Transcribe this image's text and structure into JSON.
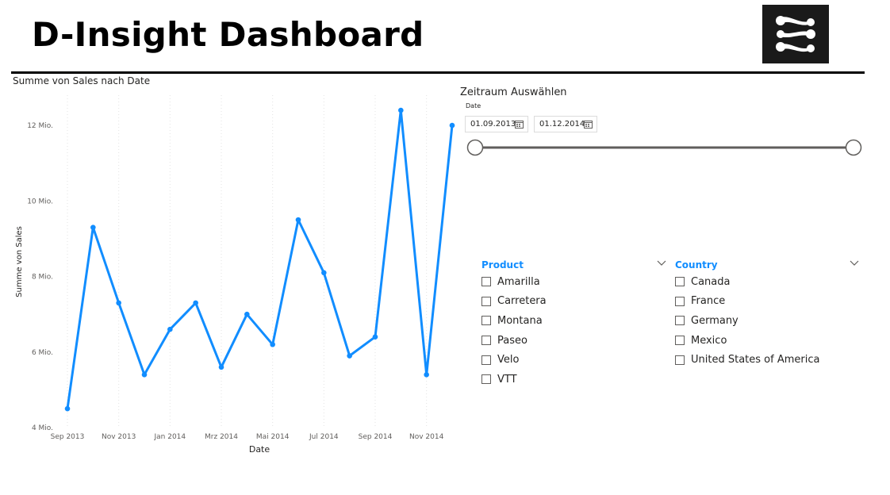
{
  "header": {
    "title": "D-Insight Dashboard",
    "logo_icon": "connected-nodes-logo-icon"
  },
  "chart_data": {
    "type": "line",
    "title": "Summe von Sales nach Date",
    "xlabel": "Date",
    "ylabel": "Summe von Sales",
    "x": [
      "2013-09",
      "2013-10",
      "2013-11",
      "2013-12",
      "2014-01",
      "2014-02",
      "2014-03",
      "2014-04",
      "2014-05",
      "2014-06",
      "2014-07",
      "2014-08",
      "2014-09",
      "2014-10",
      "2014-11",
      "2014-12"
    ],
    "x_ticks": [
      "Sep 2013",
      "Nov 2013",
      "Jan 2014",
      "Mrz 2014",
      "Mai 2014",
      "Jul 2014",
      "Sep 2014",
      "Nov 2014"
    ],
    "y_ticks": [
      "4 Mio.",
      "6 Mio.",
      "8 Mio.",
      "10 Mio.",
      "12 Mio."
    ],
    "ylim": [
      4,
      12.8
    ],
    "y_units": "Mio.",
    "series": [
      {
        "values": [
          4.5,
          9.3,
          7.3,
          5.4,
          6.6,
          7.3,
          5.6,
          7.0,
          6.2,
          9.5,
          8.1,
          5.9,
          6.4,
          12.4,
          5.4,
          12.0
        ]
      }
    ],
    "grid": "vertical dotted",
    "color": "#118dff"
  },
  "date_slicer": {
    "title": "Zeitraum Auswählen",
    "field_label": "Date",
    "start": "01.09.2013",
    "end": "01.12.2014",
    "range_fraction": [
      0,
      1
    ],
    "calendar_icon": "calendar-icon"
  },
  "filters": [
    {
      "label": "Product",
      "options": [
        "Amarilla",
        "Carretera",
        "Montana",
        "Paseo",
        "Velo",
        "VTT"
      ]
    },
    {
      "label": "Country",
      "options": [
        "Canada",
        "France",
        "Germany",
        "Mexico",
        "United States of America"
      ]
    }
  ],
  "colors": {
    "accent": "#118dff",
    "text": "#252423",
    "header_rule": "#000000",
    "logo_bg": "#1a1a1a"
  }
}
